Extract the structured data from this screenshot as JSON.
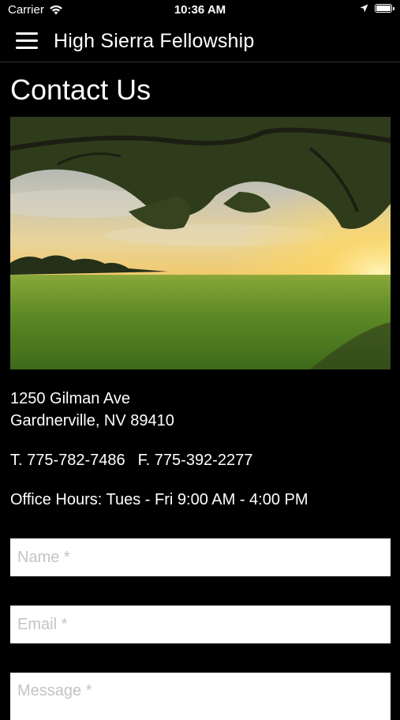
{
  "status_bar": {
    "carrier": "Carrier",
    "time": "10:36 AM",
    "icons": [
      "wifi-icon",
      "location-arrow-icon",
      "battery-icon"
    ]
  },
  "nav": {
    "title": "High Sierra Fellowship",
    "menu_icon": "hamburger-menu-icon"
  },
  "page": {
    "title": "Contact Us"
  },
  "contact": {
    "address_line1": "1250 Gilman Ave",
    "address_line2": "Gardnerville, NV 89410",
    "phone": "T. 775-782-7486",
    "fax": "F. 775-392-2277",
    "office_hours": "Office Hours: Tues - Fri 9:00 AM - 4:00 PM"
  },
  "form": {
    "name_placeholder": "Name *",
    "email_placeholder": "Email *",
    "message_placeholder": "Message *"
  },
  "colors": {
    "background": "#000000",
    "text": "#ffffff",
    "field_background": "#ffffff"
  }
}
